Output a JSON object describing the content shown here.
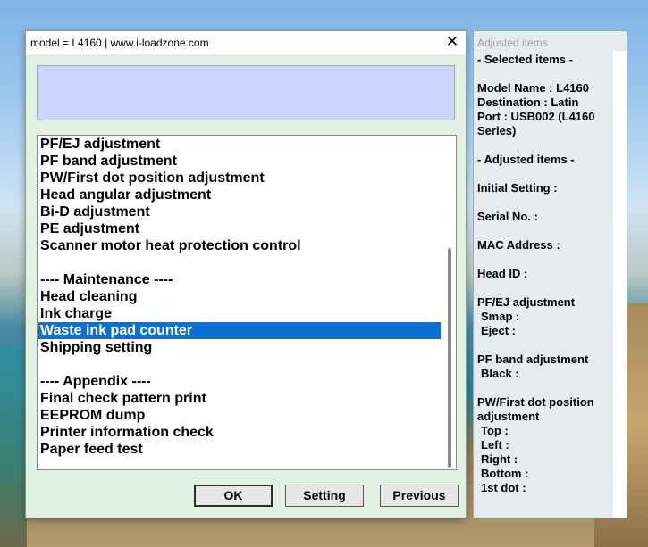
{
  "window": {
    "title": "model = L4160 | www.i-loadzone.com",
    "close_glyph": "✕"
  },
  "list": {
    "items": [
      "PF/EJ adjustment",
      "PF band adjustment",
      "PW/First dot position adjustment",
      "Head angular adjustment",
      "Bi-D adjustment",
      "PE adjustment",
      "Scanner motor heat protection control",
      "",
      "---- Maintenance ----",
      "Head cleaning",
      "Ink charge",
      "Waste ink pad counter",
      "Shipping setting",
      "",
      "---- Appendix ----",
      "Final check pattern print",
      "EEPROM dump",
      "Printer information check",
      "Paper feed test"
    ],
    "selected_index": 11
  },
  "buttons": {
    "ok": "OK",
    "setting": "Setting",
    "previous": "Previous"
  },
  "side_panel": {
    "title": "Adjusted items",
    "selected_header": "- Selected items -",
    "model_name": "Model Name : L4160",
    "destination": "Destination : Latin",
    "port": "Port : USB002 (L4160",
    "port_cont": "Series)",
    "adjusted_header": "- Adjusted items -",
    "initial_setting": "Initial Setting :",
    "serial_no": "Serial No. :",
    "mac_address": "MAC Address :",
    "head_id": "Head ID :",
    "pfej": "PF/EJ adjustment",
    "smap": "Smap :",
    "eject": "Eject :",
    "pf_band": "PF band adjustment",
    "black": "Black :",
    "pw_first": "PW/First dot position",
    "pw_first_cont": "adjustment",
    "top": "Top :",
    "left": "Left :",
    "right": "Right :",
    "bottom": "Bottom :",
    "first_dot": "1st dot :"
  }
}
